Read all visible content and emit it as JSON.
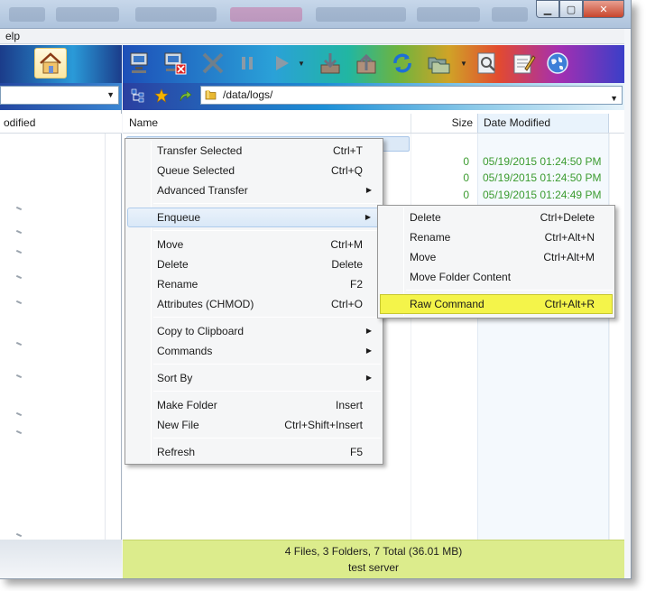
{
  "menubar": {
    "help_label": "elp"
  },
  "left_pane": {
    "header_label": "odified"
  },
  "right_pane": {
    "path": "/data/logs/",
    "columns": {
      "name": "Name",
      "size": "Size",
      "date_modified": "Date Modified"
    },
    "rows": [
      {
        "size": "0",
        "date": "05/19/2015 01:24:50 PM"
      },
      {
        "size": "0",
        "date": "05/19/2015 01:24:50 PM"
      },
      {
        "size": "0",
        "date": "05/19/2015 01:24:49 PM"
      }
    ],
    "status": {
      "summary": "4 Files, 3 Folders, 7 Total (36.01 MB)",
      "server": "test server"
    }
  },
  "context_menu": {
    "items": [
      {
        "label": "Transfer Selected",
        "shortcut": "Ctrl+T"
      },
      {
        "label": "Queue Selected",
        "shortcut": "Ctrl+Q"
      },
      {
        "label": "Advanced Transfer",
        "shortcut": ""
      },
      {
        "label": "Enqueue",
        "shortcut": ""
      },
      {
        "label": "Move",
        "shortcut": "Ctrl+M"
      },
      {
        "label": "Delete",
        "shortcut": "Delete"
      },
      {
        "label": "Rename",
        "shortcut": "F2"
      },
      {
        "label": "Attributes (CHMOD)",
        "shortcut": "Ctrl+O"
      },
      {
        "label": "Copy to Clipboard",
        "shortcut": ""
      },
      {
        "label": "Commands",
        "shortcut": ""
      },
      {
        "label": "Sort By",
        "shortcut": ""
      },
      {
        "label": "Make Folder",
        "shortcut": "Insert"
      },
      {
        "label": "New File",
        "shortcut": "Ctrl+Shift+Insert"
      },
      {
        "label": "Refresh",
        "shortcut": "F5"
      }
    ]
  },
  "enqueue_submenu": {
    "items": [
      {
        "label": "Delete",
        "shortcut": "Ctrl+Delete"
      },
      {
        "label": "Rename",
        "shortcut": "Ctrl+Alt+N"
      },
      {
        "label": "Move",
        "shortcut": "Ctrl+Alt+M"
      },
      {
        "label": "Move Folder Content",
        "shortcut": ""
      },
      {
        "label": "Raw Command",
        "shortcut": "Ctrl+Alt+R"
      }
    ]
  },
  "colors": {
    "status_bar": "#dcec8c",
    "highlight": "#f4f44a",
    "file_text": "#3b9b2f"
  },
  "icons": [
    "house-icon",
    "connect-icon",
    "disconnect-icon",
    "stop-icon",
    "pause-icon",
    "play-icon",
    "download-icon",
    "upload-icon",
    "refresh-icon",
    "folders-icon",
    "search-icon",
    "notepad-icon",
    "globe-icon",
    "tree-icon",
    "star-icon",
    "up-arrow-icon",
    "folder-icon",
    "minimize-icon",
    "maximize-icon",
    "close-icon"
  ]
}
